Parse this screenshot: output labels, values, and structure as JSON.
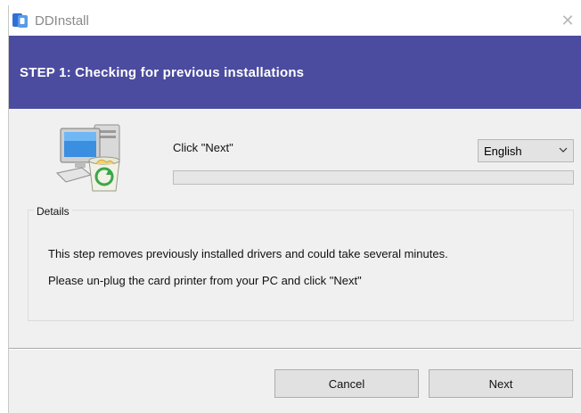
{
  "window": {
    "title": "DDInstall",
    "close_glyph": "✕"
  },
  "banner": {
    "title": "STEP 1: Checking for previous installations",
    "background": "#4b4b9f"
  },
  "main": {
    "instruction": "Click \"Next\"",
    "language": {
      "selected": "English"
    },
    "progress": {
      "value": 0
    },
    "icon": "computer-recycle-icon"
  },
  "details": {
    "legend": "Details",
    "lines": [
      "This step removes previously installed drivers and could take several minutes.",
      "Please un-plug the card printer from your PC and click \"Next\""
    ]
  },
  "footer": {
    "cancel_label": "Cancel",
    "next_label": "Next"
  }
}
